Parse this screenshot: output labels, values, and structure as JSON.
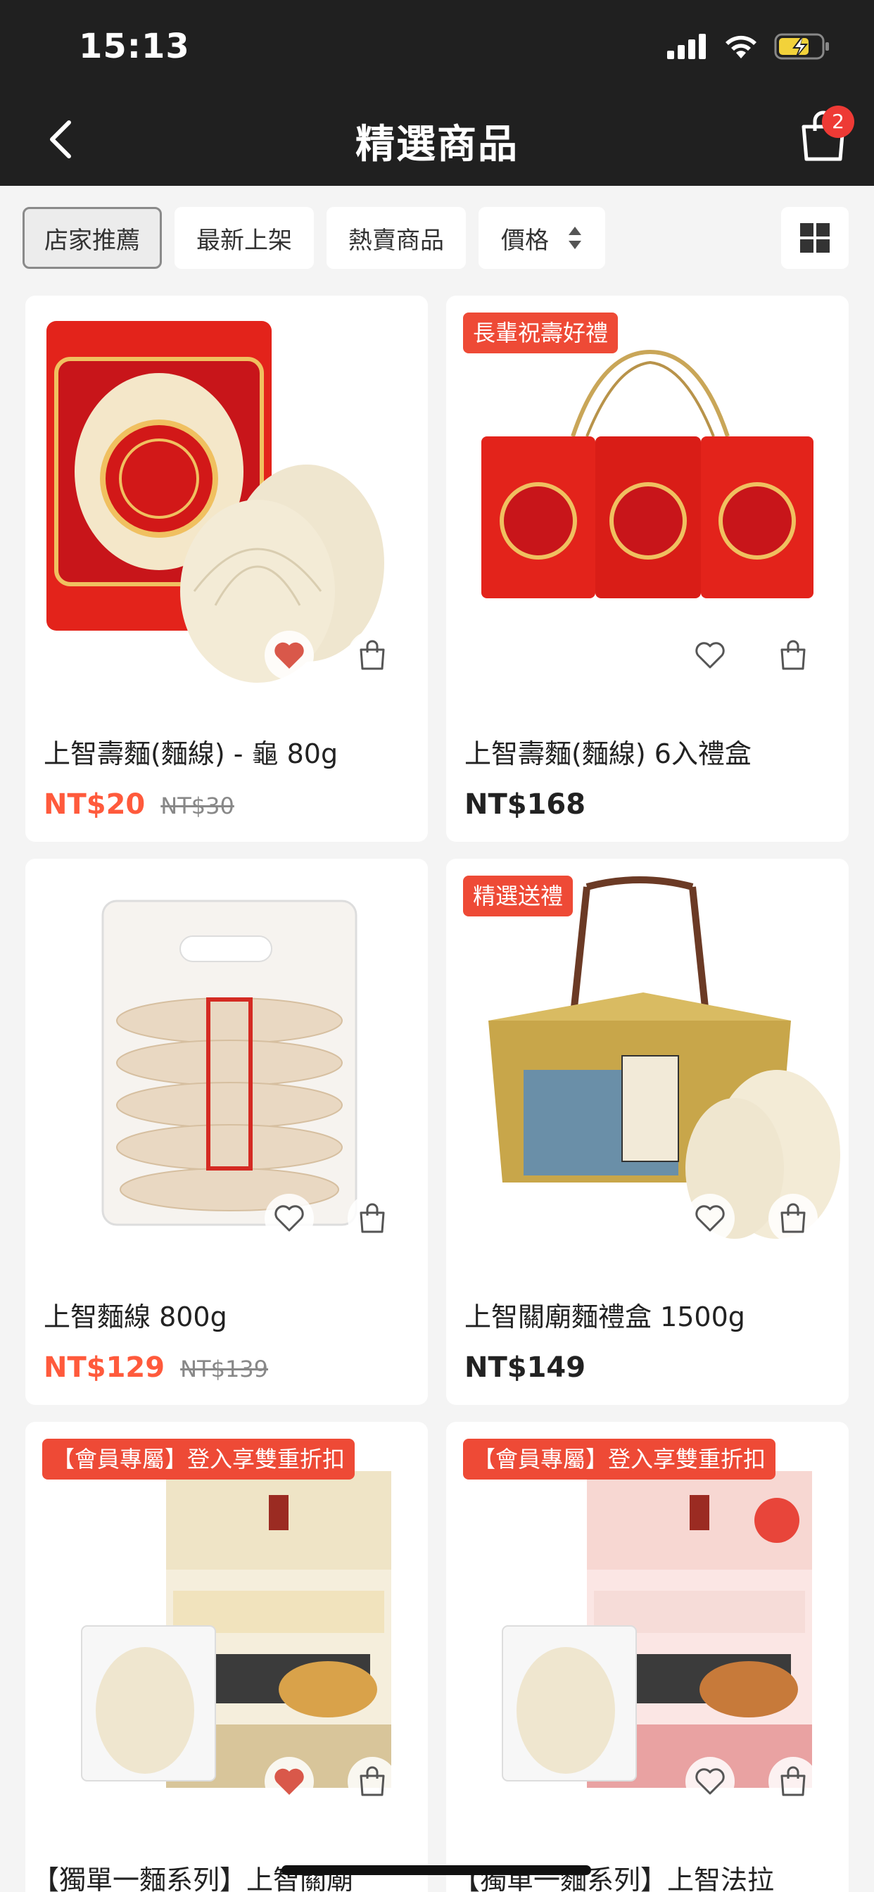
{
  "status": {
    "time": "15:13"
  },
  "header": {
    "title": "精選商品",
    "cart_count": "2"
  },
  "filters": [
    {
      "label": "店家推薦",
      "active": true
    },
    {
      "label": "最新上架",
      "active": false
    },
    {
      "label": "熱賣商品",
      "active": false
    },
    {
      "label": "價格",
      "active": false
    }
  ],
  "products": [
    {
      "name": "上智壽麵(麵線) - 龜 80g",
      "price": "NT$20",
      "old_price": "NT$30",
      "tag": "",
      "favorited": true
    },
    {
      "name": "上智壽麵(麵線) 6入禮盒",
      "price": "NT$168",
      "old_price": "",
      "tag": "長輩祝壽好禮",
      "favorited": false
    },
    {
      "name": "上智麵線 800g",
      "price": "NT$129",
      "old_price": "NT$139",
      "tag": "",
      "favorited": false
    },
    {
      "name": "上智關廟麵禮盒 1500g",
      "price": "NT$149",
      "old_price": "",
      "tag": "精選送禮",
      "favorited": false
    },
    {
      "name": "【獨單一麵系列】上智關廟",
      "price": "",
      "old_price": "",
      "tag": "【會員專屬】登入享雙重折扣",
      "favorited": true
    },
    {
      "name": "【獨單一麵系列】上智法拉",
      "price": "",
      "old_price": "",
      "tag": "【會員專屬】登入享雙重折扣",
      "favorited": false
    }
  ],
  "colors": {
    "header_bg": "#202020",
    "accent": "#ff5a3c",
    "tag_bg": "#ee4a36",
    "badge": "#ee3a35"
  }
}
